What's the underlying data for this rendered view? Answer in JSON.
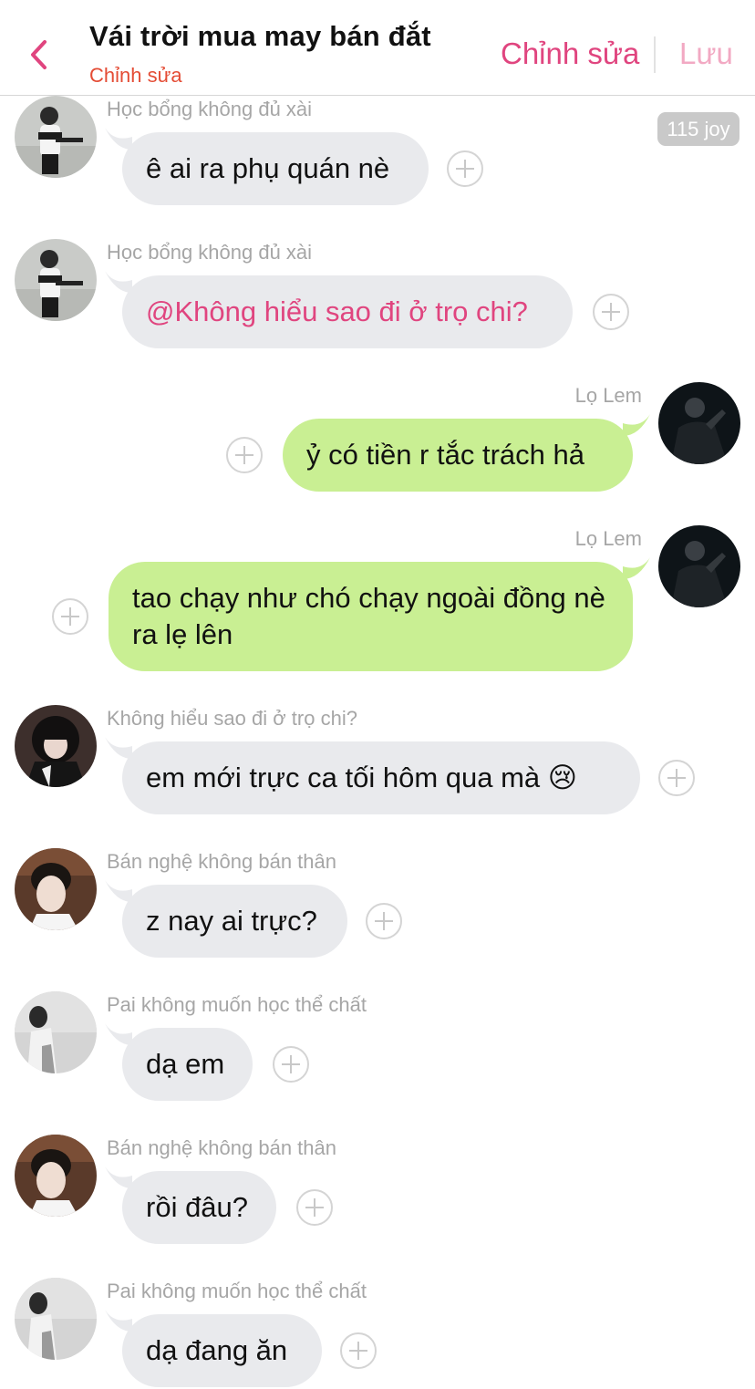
{
  "header": {
    "title": "Vái trời mua may bán đắt",
    "subtitle": "Chỉnh sửa",
    "edit_label": "Chỉnh sửa",
    "save_label": "Lưu"
  },
  "joy_badge": "115 joy",
  "colors": {
    "accent": "#e0457f",
    "subtitle": "#e44c35",
    "incoming_bubble": "#e9eaed",
    "outgoing_bubble": "#c9ef93",
    "save_disabled": "#f2a9c3"
  },
  "messages": [
    {
      "sender": "Học bổng không đủ xài",
      "text": "ê ai ra phụ quán nè",
      "direction": "incoming",
      "avatar": "avatar-gun-pose"
    },
    {
      "sender": "Học bổng không đủ xài",
      "text": "@Không hiểu sao đi ở trọ chi?",
      "direction": "incoming",
      "avatar": "avatar-gun-pose",
      "mention": true
    },
    {
      "sender": "Lọ Lem",
      "text": "ỷ có tiền r tắc trách hả",
      "direction": "outgoing",
      "avatar": "avatar-dark-suit"
    },
    {
      "sender": "Lọ Lem",
      "text": "tao chạy như chó chạy ngoài đồng nè ra lẹ lên",
      "direction": "outgoing",
      "avatar": "avatar-dark-suit"
    },
    {
      "sender": "Không hiểu sao đi ở trọ chi?",
      "text": "em mới trực ca tối hôm qua mà 😢",
      "direction": "incoming",
      "avatar": "avatar-black-hair"
    },
    {
      "sender": "Bán nghệ không bán thân",
      "text": "z nay ai trực?",
      "direction": "incoming",
      "avatar": "avatar-short-hair"
    },
    {
      "sender": "Pai không muốn học thể chất",
      "text": "dạ em",
      "direction": "incoming",
      "avatar": "avatar-grayscale"
    },
    {
      "sender": "Bán nghệ không bán thân",
      "text": "rồi đâu?",
      "direction": "incoming",
      "avatar": "avatar-short-hair"
    },
    {
      "sender": "Pai không muốn học thể chất",
      "text": "dạ đang ăn",
      "direction": "incoming",
      "avatar": "avatar-grayscale"
    }
  ]
}
